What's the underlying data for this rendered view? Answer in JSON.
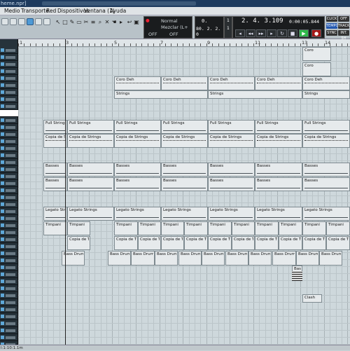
{
  "window": {
    "title": "heme.npr]"
  },
  "menu": [
    "Medio",
    "Transporte",
    "Red",
    "Dispositivos",
    "Ventana (1)",
    "Ayuda"
  ],
  "panel_left": {
    "mode1": "Normal",
    "mode2": "Mezclar (L+",
    "off1": "OFF",
    "off2": "OFF"
  },
  "panel_mid": {
    "top": "0.",
    "bottom": "80. 2. 2. 0",
    "sub1": "1",
    "sub2": "1"
  },
  "transport": {
    "position": "2. 4. 3.109",
    "time": "0:00:05.844"
  },
  "side_labels": [
    "CLICK",
    "OFF",
    "TEMPO",
    "TRACK",
    "SYNC",
    "INT. 5H"
  ],
  "ruler": [
    "1",
    "3",
    "5",
    "7",
    "9",
    "11",
    "13",
    "14"
  ],
  "status": "l:1:10:1.1m",
  "parts": {
    "coro": "Coro",
    "coro_deh": "Coro Deh",
    "strings": "Strings",
    "full_strings": "Full Strings",
    "copia_strings": "Copia de Strings",
    "copia_st": "Copia de St",
    "basses": "Basses",
    "legato": "Legato Strings",
    "legato_short": "Legato Strin",
    "timpani": "Timpani",
    "copia_tim": "Copia de Tim",
    "bass_drum": "Bass Drum",
    "bass_short": "Bass",
    "clash": "Clash"
  },
  "colors": {
    "accent": "#2fb84a",
    "record": "#a51616",
    "highlight": "#4e9ad6"
  }
}
